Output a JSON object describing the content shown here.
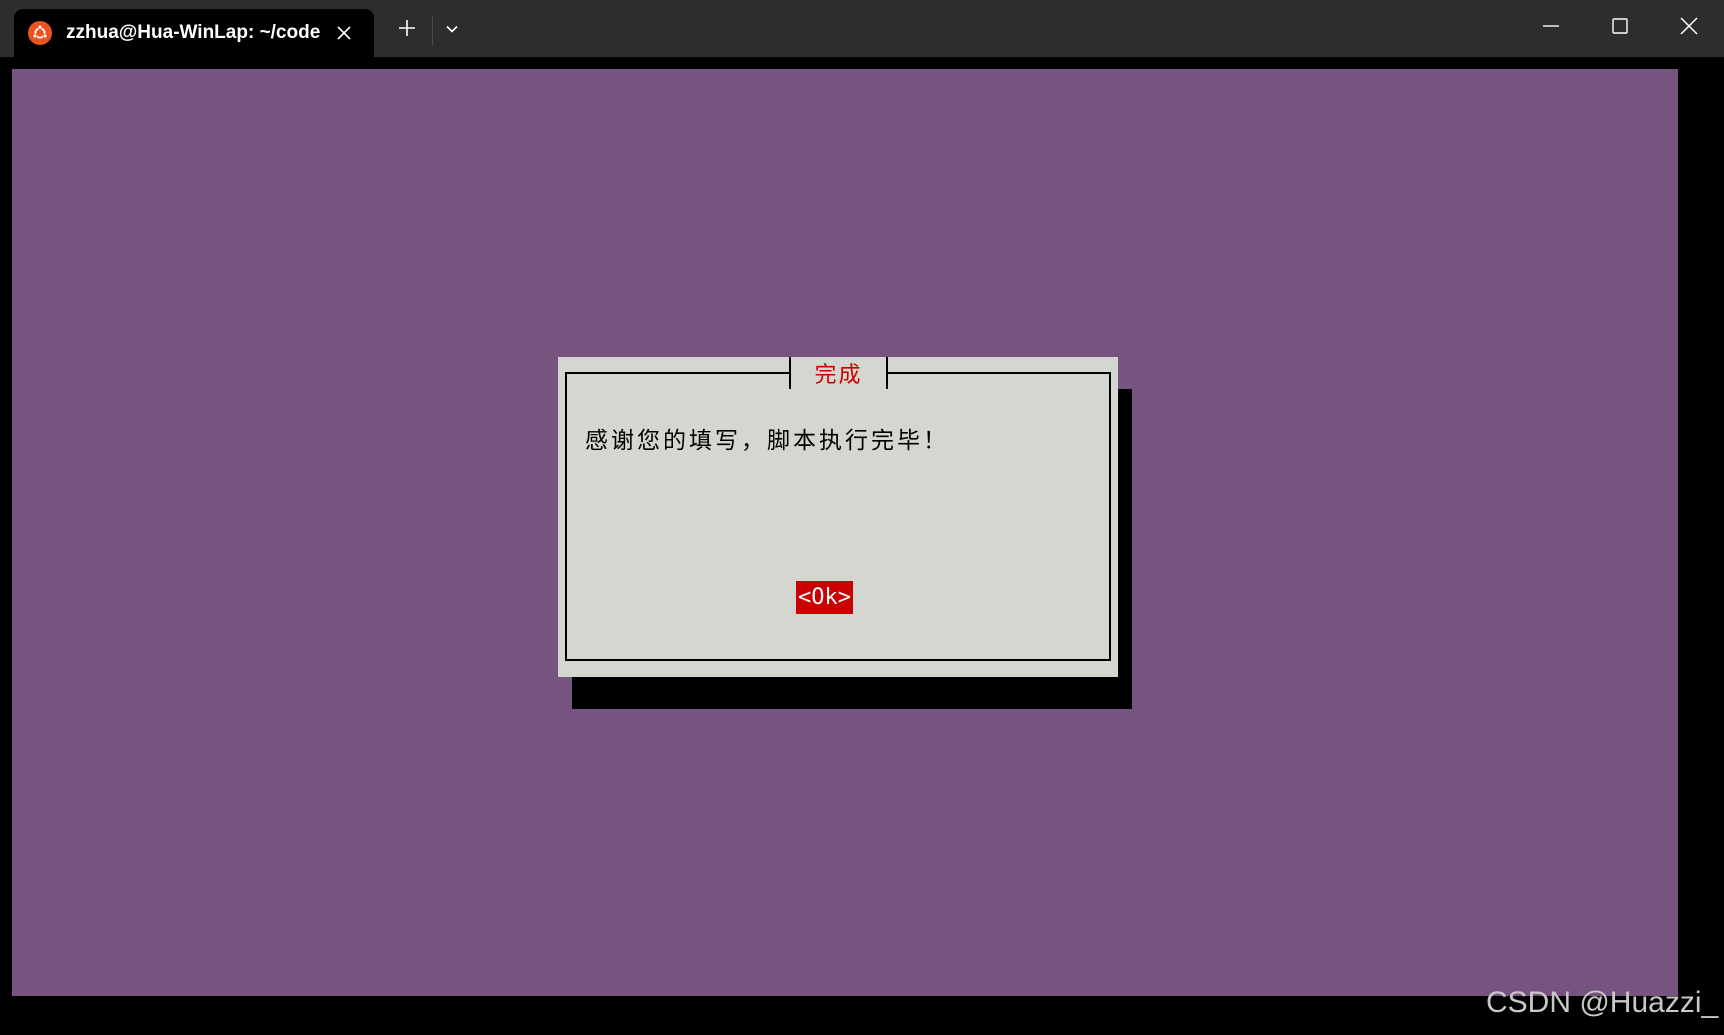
{
  "window": {
    "tab_title": "zzhua@Hua-WinLap: ~/code",
    "tab_icon": "ubuntu-icon",
    "new_tab_icon": "plus-icon",
    "dropdown_icon": "chevron-down-icon",
    "controls": [
      "minimize-icon",
      "maximize-icon",
      "close-icon"
    ]
  },
  "dialog": {
    "title": "完成",
    "message": "感谢您的填写，脚本执行完毕！",
    "ok_label": "<Ok>"
  },
  "watermark": "CSDN @Huazzi_",
  "colors": {
    "titlebar": "#2d2d2d",
    "terminal_bg": "#000000",
    "dialog_backdrop": "#775380",
    "dialog_panel": "#d3d7cf",
    "accent_red": "#cc0000",
    "ubuntu_orange": "#e95420"
  }
}
